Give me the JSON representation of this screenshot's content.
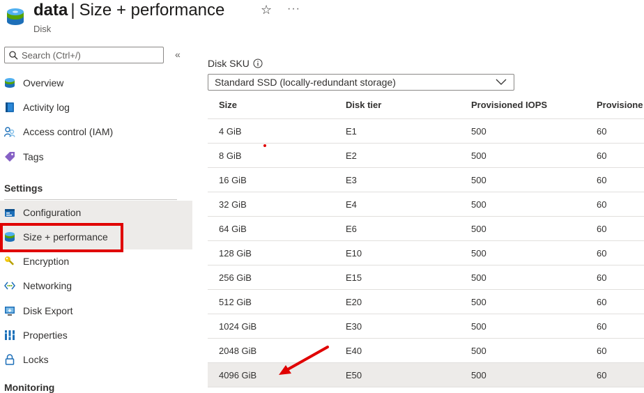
{
  "header": {
    "resource_name": "data",
    "separator": "|",
    "page_name": "Size + performance",
    "resource_type": "Disk",
    "favorite_icon": "star-icon",
    "more_label": "···"
  },
  "sidebar": {
    "search_placeholder": "Search (Ctrl+/)",
    "collapse_label": "«",
    "items_top": [
      {
        "label": "Overview",
        "icon": "disk-icon"
      },
      {
        "label": "Activity log",
        "icon": "activity-log-icon"
      },
      {
        "label": "Access control (IAM)",
        "icon": "iam-icon"
      },
      {
        "label": "Tags",
        "icon": "tag-icon"
      }
    ],
    "settings_header": "Settings",
    "items_settings": [
      {
        "label": "Configuration",
        "icon": "configuration-icon"
      },
      {
        "label": "Size + performance",
        "icon": "disk-icon"
      },
      {
        "label": "Encryption",
        "icon": "key-icon"
      },
      {
        "label": "Networking",
        "icon": "networking-icon"
      },
      {
        "label": "Disk Export",
        "icon": "export-icon"
      },
      {
        "label": "Properties",
        "icon": "properties-icon"
      },
      {
        "label": "Locks",
        "icon": "lock-icon"
      }
    ],
    "monitoring_header_partial": "Monitoring"
  },
  "main": {
    "sku_label": "Disk SKU",
    "sku_selected": "Standard SSD (locally-redundant storage)",
    "table": {
      "columns": [
        "Size",
        "Disk tier",
        "Provisioned IOPS",
        "Provisione"
      ],
      "rows": [
        {
          "size": "4 GiB",
          "tier": "E1",
          "iops": "500",
          "tput": "60"
        },
        {
          "size": "8 GiB",
          "tier": "E2",
          "iops": "500",
          "tput": "60"
        },
        {
          "size": "16 GiB",
          "tier": "E3",
          "iops": "500",
          "tput": "60"
        },
        {
          "size": "32 GiB",
          "tier": "E4",
          "iops": "500",
          "tput": "60"
        },
        {
          "size": "64 GiB",
          "tier": "E6",
          "iops": "500",
          "tput": "60"
        },
        {
          "size": "128 GiB",
          "tier": "E10",
          "iops": "500",
          "tput": "60"
        },
        {
          "size": "256 GiB",
          "tier": "E15",
          "iops": "500",
          "tput": "60"
        },
        {
          "size": "512 GiB",
          "tier": "E20",
          "iops": "500",
          "tput": "60"
        },
        {
          "size": "1024 GiB",
          "tier": "E30",
          "iops": "500",
          "tput": "60"
        },
        {
          "size": "2048 GiB",
          "tier": "E40",
          "iops": "500",
          "tput": "60"
        },
        {
          "size": "4096 GiB",
          "tier": "E50",
          "iops": "500",
          "tput": "60"
        }
      ],
      "selected_row_index": 10
    }
  },
  "colors": {
    "annotation_red": "#e00000",
    "selected_bg": "#edebe9",
    "azure_blue": "#0078d4",
    "disk_green": "#57a300"
  }
}
